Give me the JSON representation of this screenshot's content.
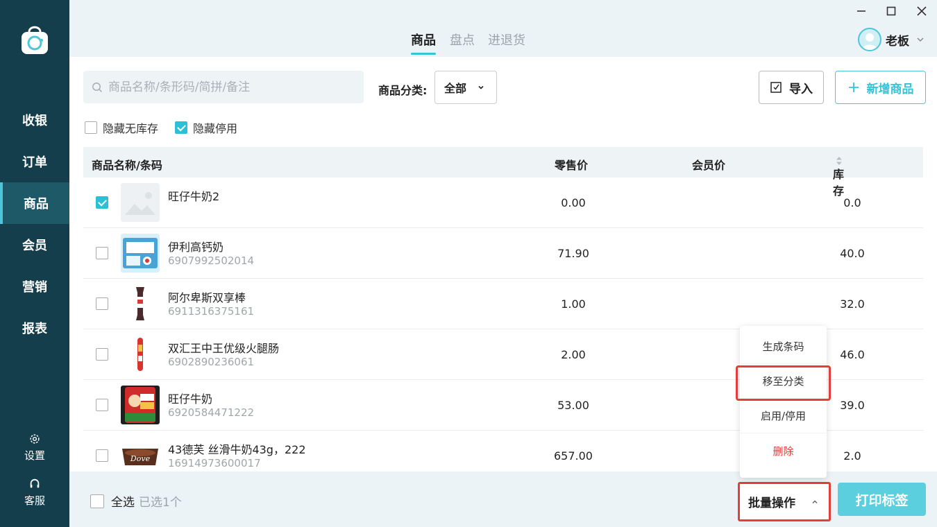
{
  "sidebar": {
    "items": [
      {
        "label": "收银"
      },
      {
        "label": "订单"
      },
      {
        "label": "商品"
      },
      {
        "label": "会员"
      },
      {
        "label": "营销"
      },
      {
        "label": "报表"
      }
    ],
    "active_index": 2,
    "settings_label": "设置",
    "support_label": "客服"
  },
  "header": {
    "tabs": [
      {
        "label": "商品"
      },
      {
        "label": "盘点"
      },
      {
        "label": "进退货"
      }
    ],
    "active_tab": 0,
    "user_name": "老板"
  },
  "toolbar": {
    "search_placeholder": "商品名称/条形码/简拼/备注",
    "category_label": "商品分类:",
    "category_value": "全部",
    "import_label": "导入",
    "new_label": "新增商品"
  },
  "filters": [
    {
      "label": "隐藏无库存",
      "checked": false
    },
    {
      "label": "隐藏停用",
      "checked": true
    }
  ],
  "table": {
    "headers": {
      "name": "商品名称/条码",
      "retail": "零售价",
      "member": "会员价",
      "stock": "库存"
    },
    "rows": [
      {
        "name": "旺仔牛奶2",
        "code": "",
        "price": "0.00",
        "stock": "0.0",
        "checked": true
      },
      {
        "name": "伊利高钙奶",
        "code": "6907992502014",
        "price": "71.90",
        "stock": "40.0",
        "checked": false
      },
      {
        "name": "阿尔卑斯双享棒",
        "code": "6911316375161",
        "price": "1.00",
        "stock": "32.0",
        "checked": false
      },
      {
        "name": "双汇王中王优级火腿肠",
        "code": "6902890236061",
        "price": "2.00",
        "stock": "46.0",
        "checked": false
      },
      {
        "name": "旺仔牛奶",
        "code": "6920584471222",
        "price": "53.00",
        "stock": "39.0",
        "checked": false
      },
      {
        "name": "43德芙 丝滑牛奶43g，222",
        "code": "16914973600017",
        "price": "657.00",
        "stock": "2.0",
        "checked": false
      }
    ]
  },
  "footer": {
    "select_all": "全选",
    "selected_count": "已选1个",
    "batch_label": "批量操作",
    "print_label": "打印标签"
  },
  "batch_menu": {
    "items": [
      {
        "label": "生成条码"
      },
      {
        "label": "移至分类"
      },
      {
        "label": "启用/停用"
      },
      {
        "label": "删除"
      }
    ]
  },
  "colors": {
    "sidebar_bg": "#153e4c",
    "accent": "#35c3d6",
    "danger": "#e53c3c"
  }
}
